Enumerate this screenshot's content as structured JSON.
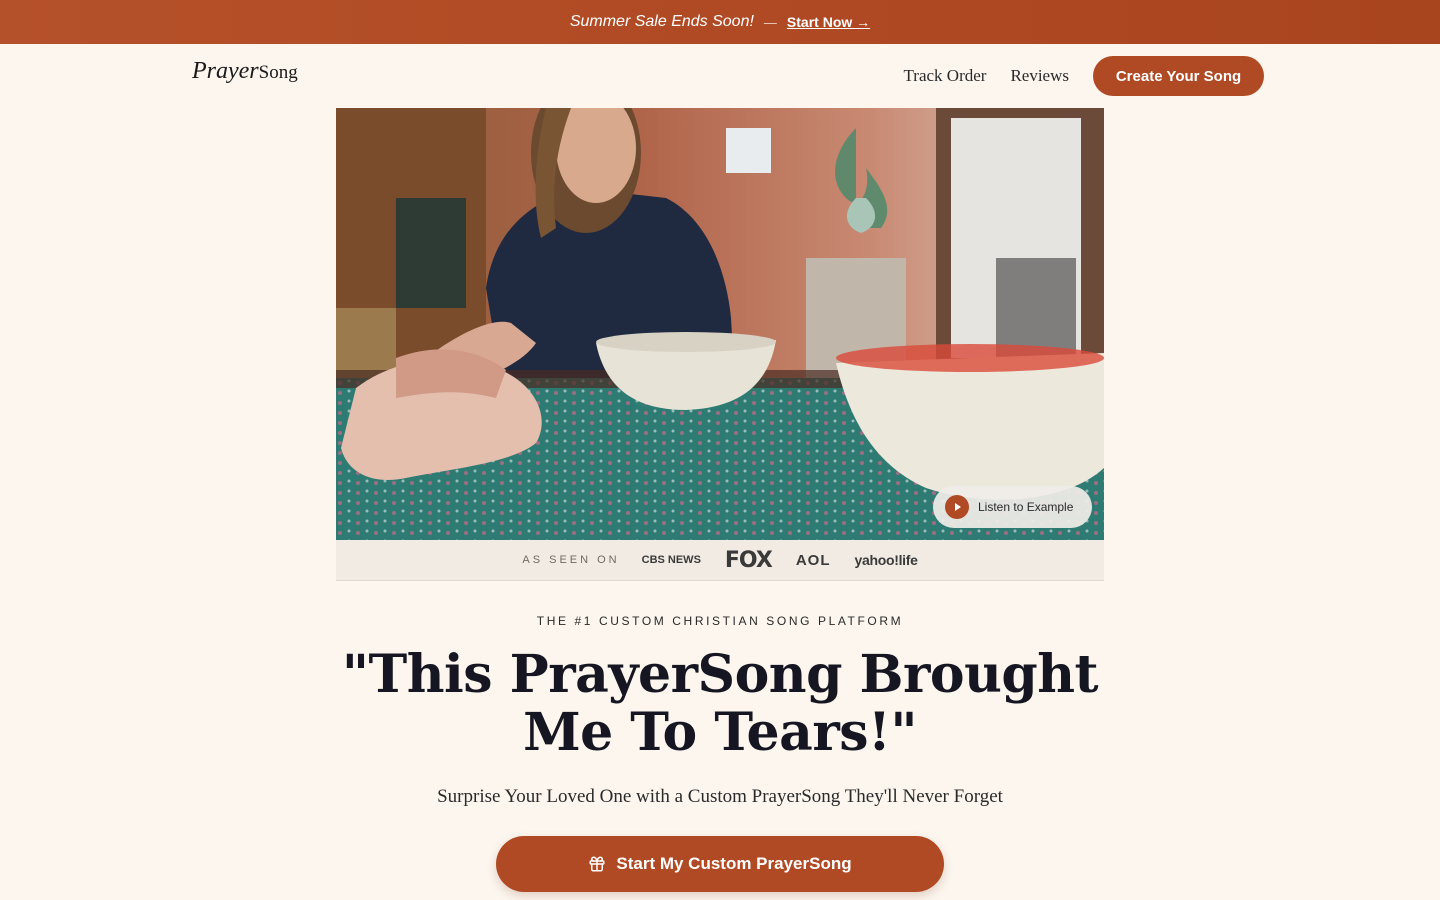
{
  "promo": {
    "text": "Summer Sale Ends Soon!",
    "separator": "—",
    "link_label": "Start Now →"
  },
  "header": {
    "logo_part1": "Prayer",
    "logo_part2": "Song",
    "nav": {
      "track_order": "Track Order",
      "reviews": "Reviews",
      "cta": "Create Your Song"
    }
  },
  "hero": {
    "listen_label": "Listen to Example",
    "play_icon": "play-icon"
  },
  "as_seen_on": {
    "label": "AS SEEN ON",
    "logos": [
      "CBS NEWS",
      "FOX",
      "AOL",
      "yahoo!life"
    ]
  },
  "main": {
    "eyebrow": "THE #1 CUSTOM CHRISTIAN SONG PLATFORM",
    "headline": "\"This PrayerSong Brought Me To Tears!\"",
    "subheadline": "Surprise Your Loved One with a Custom PrayerSong They'll Never Forget",
    "cta_label": "Start My Custom PrayerSong",
    "cta_icon": "gift-icon"
  },
  "colors": {
    "brand": "#b04a24",
    "background": "#fcf6ef",
    "text": "#161622"
  }
}
